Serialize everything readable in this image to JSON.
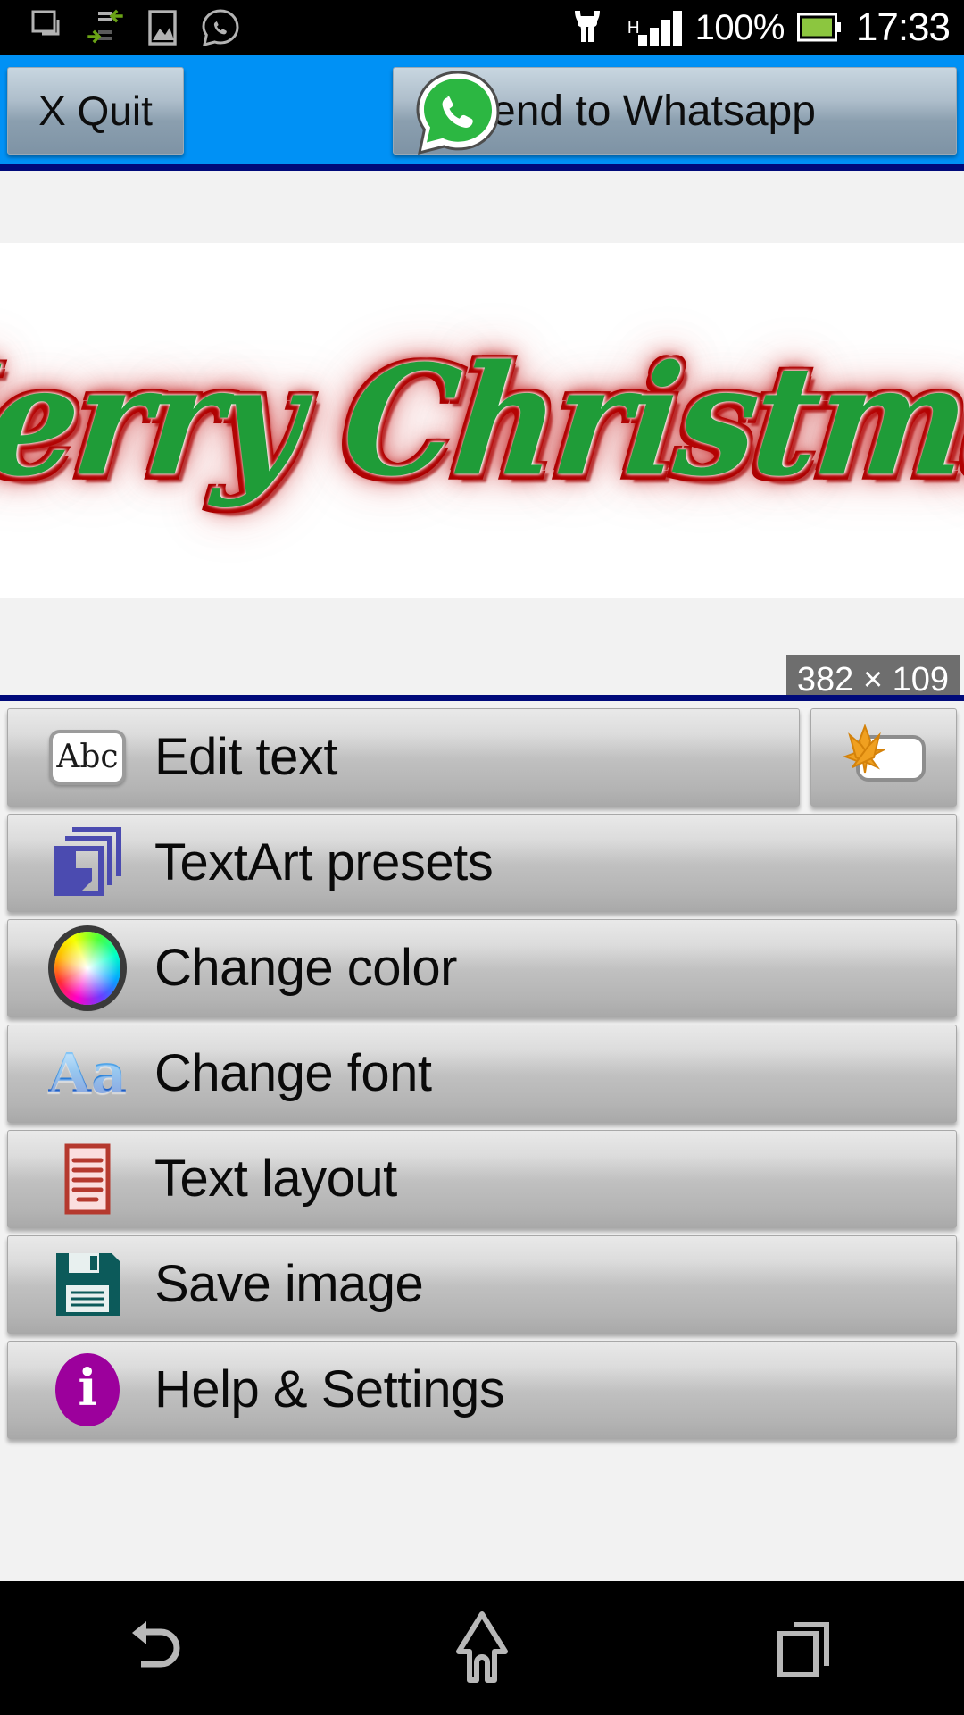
{
  "status_bar": {
    "icons": [
      "screenshot-icon",
      "data-transfer-icon",
      "gallery-image-icon",
      "whatsapp-icon"
    ],
    "usb_icon": "usb-connection-icon",
    "network_type": "H",
    "signal_icon": "signal-bars-icon",
    "battery_percent": "100%",
    "battery_icon": "battery-full-icon",
    "clock": "17:33"
  },
  "toolbar": {
    "background_color": "#0091f5",
    "quit_label": "X Quit",
    "send_label": "Send to Whatsapp",
    "send_icon": "whatsapp-icon"
  },
  "canvas": {
    "artwork_text": "Merry Christmas",
    "fill_color": "#1f9c38",
    "outline_color": "#b80000",
    "glow_color": "#c81414",
    "size_badge": "382 × 109"
  },
  "menu": {
    "items": [
      {
        "label": "Edit text",
        "icon": "abc-text-icon",
        "name": "edit-text"
      },
      {
        "label": "TextArt presets",
        "icon": "layers-stack-icon",
        "name": "textart-presets"
      },
      {
        "label": "Change color",
        "icon": "color-wheel-icon",
        "name": "change-color"
      },
      {
        "label": "Change font",
        "icon": "aa-font-icon",
        "name": "change-font"
      },
      {
        "label": "Text layout",
        "icon": "document-lines-icon",
        "name": "text-layout"
      },
      {
        "label": "Save image",
        "icon": "floppy-disk-icon",
        "name": "save-image"
      },
      {
        "label": "Help & Settings",
        "icon": "info-circle-icon",
        "name": "help-settings"
      }
    ],
    "side_button": {
      "icon": "sparkle-effects-icon",
      "name": "text-effects"
    },
    "abc_icon_text": "Abc",
    "aa_icon_text": "Aa",
    "info_icon_text": "i"
  },
  "navbar": {
    "back": "back-icon",
    "home": "home-icon",
    "recents": "recents-icon"
  }
}
